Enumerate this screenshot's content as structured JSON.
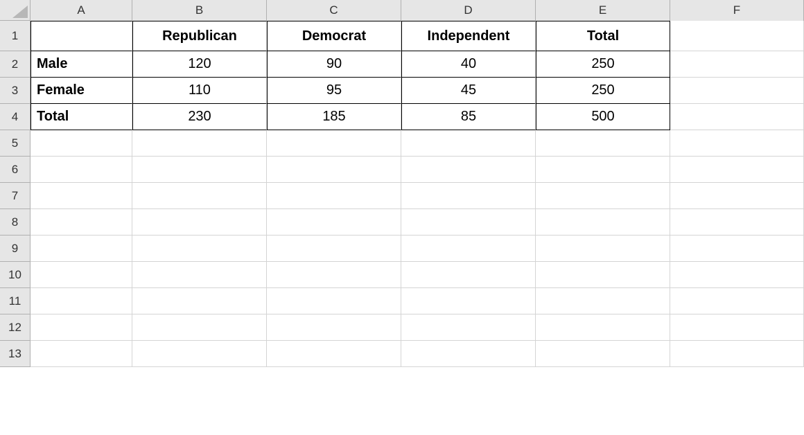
{
  "columns": [
    "A",
    "B",
    "C",
    "D",
    "E",
    "F"
  ],
  "rowNumbers": [
    "1",
    "2",
    "3",
    "4",
    "5",
    "6",
    "7",
    "8",
    "9",
    "10",
    "11",
    "12",
    "13"
  ],
  "table": {
    "header": {
      "a": "",
      "b": "Republican",
      "c": "Democrat",
      "d": "Independent",
      "e": "Total"
    },
    "rows": [
      {
        "label": "Male",
        "b": "120",
        "c": "90",
        "d": "40",
        "e": "250"
      },
      {
        "label": "Female",
        "b": "110",
        "c": "95",
        "d": "45",
        "e": "250"
      },
      {
        "label": "Total",
        "b": "230",
        "c": "185",
        "d": "85",
        "e": "500"
      }
    ]
  },
  "chart_data": {
    "type": "table",
    "title": "",
    "columns": [
      "",
      "Republican",
      "Democrat",
      "Independent",
      "Total"
    ],
    "rows": [
      [
        "Male",
        120,
        90,
        40,
        250
      ],
      [
        "Female",
        110,
        95,
        45,
        250
      ],
      [
        "Total",
        230,
        185,
        85,
        500
      ]
    ]
  }
}
